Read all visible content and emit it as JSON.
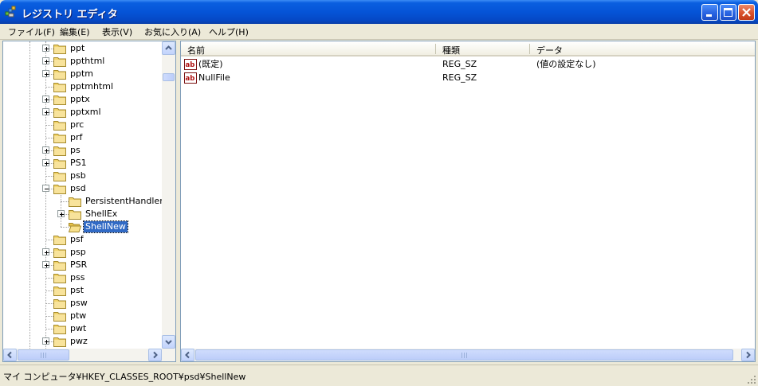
{
  "window": {
    "title": "レジストリ エディタ"
  },
  "menu": [
    "ファイル(F)",
    "編集(E)",
    "表示(V)",
    "お気に入り(A)",
    "ヘルプ(H)"
  ],
  "tree": [
    {
      "label": "ppt",
      "expander": true,
      "level": 1
    },
    {
      "label": "ppthtml",
      "expander": true,
      "level": 1
    },
    {
      "label": "pptm",
      "expander": true,
      "level": 1
    },
    {
      "label": "pptmhtml",
      "expander": false,
      "level": 1
    },
    {
      "label": "pptx",
      "expander": true,
      "level": 1
    },
    {
      "label": "pptxml",
      "expander": true,
      "level": 1
    },
    {
      "label": "prc",
      "expander": false,
      "level": 1
    },
    {
      "label": "prf",
      "expander": false,
      "level": 1
    },
    {
      "label": "ps",
      "expander": true,
      "level": 1
    },
    {
      "label": "PS1",
      "expander": true,
      "level": 1
    },
    {
      "label": "psb",
      "expander": false,
      "level": 1
    },
    {
      "label": "psd",
      "expander": "minus",
      "level": 1
    },
    {
      "label": "PersistentHandler",
      "expander": false,
      "level": 2
    },
    {
      "label": "ShellEx",
      "expander": true,
      "level": 2
    },
    {
      "label": "ShellNew",
      "expander": false,
      "level": 2,
      "selected": true,
      "open": true
    },
    {
      "label": "psf",
      "expander": false,
      "level": 1
    },
    {
      "label": "psp",
      "expander": true,
      "level": 1
    },
    {
      "label": "PSR",
      "expander": true,
      "level": 1
    },
    {
      "label": "pss",
      "expander": false,
      "level": 1
    },
    {
      "label": "pst",
      "expander": false,
      "level": 1
    },
    {
      "label": "psw",
      "expander": false,
      "level": 1
    },
    {
      "label": "ptw",
      "expander": false,
      "level": 1
    },
    {
      "label": "pwt",
      "expander": false,
      "level": 1
    },
    {
      "label": "pwz",
      "expander": true,
      "level": 1
    }
  ],
  "columns": {
    "name": "名前",
    "type": "種類",
    "data": "データ"
  },
  "values": [
    {
      "name": "(既定)",
      "type": "REG_SZ",
      "data": "(値の設定なし)"
    },
    {
      "name": "NullFile",
      "type": "REG_SZ",
      "data": ""
    }
  ],
  "status": {
    "path": "マイ コンピュータ¥HKEY_CLASSES_ROOT¥psd¥ShellNew"
  },
  "colors": {
    "title_bar": "#0554d7",
    "selection": "#316ac5",
    "folder": "#f2d46b"
  }
}
